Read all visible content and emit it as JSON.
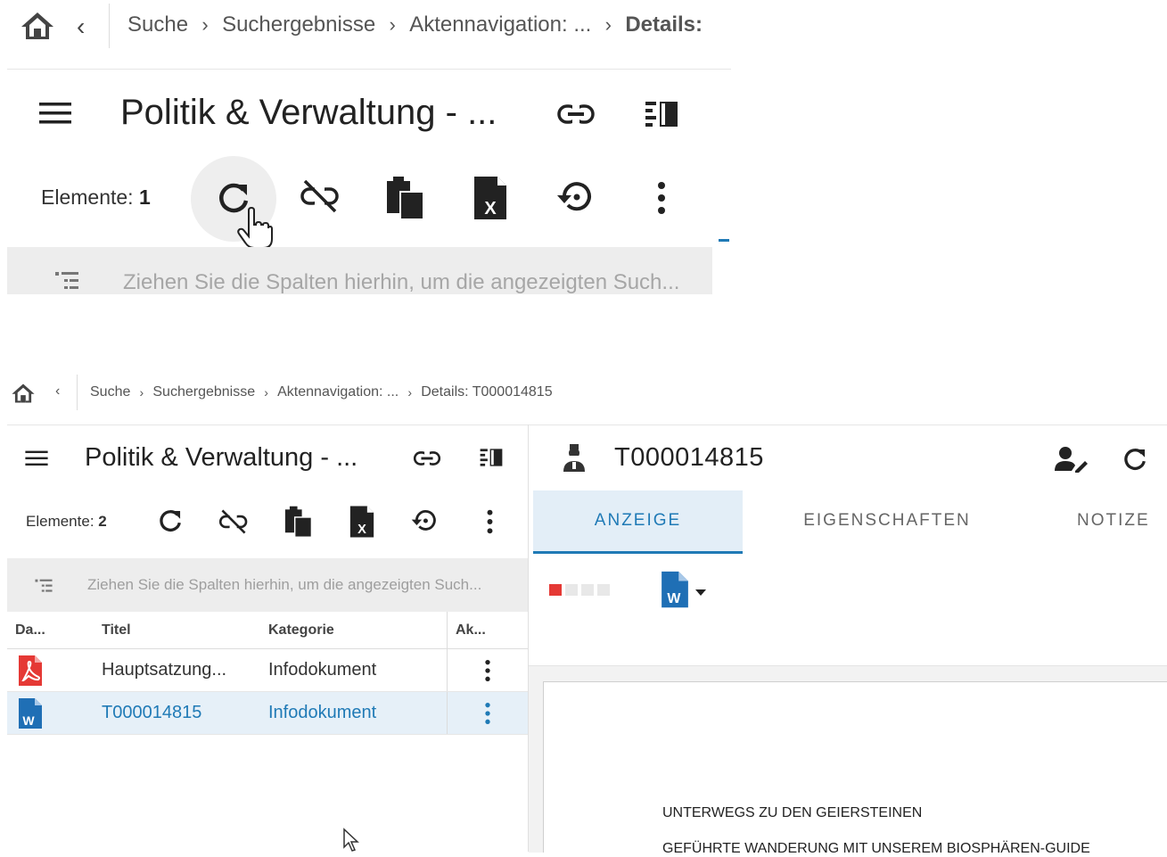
{
  "zoom": {
    "breadcrumb": [
      "Suche",
      "Suchergebnisse",
      "Aktennavigation: ...",
      "Details:"
    ],
    "title": "Politik & Verwaltung - ...",
    "count_label": "Elemente:",
    "count_value": "1",
    "group_hint": "Ziehen Sie die Spalten hierhin, um die angezeigten Such..."
  },
  "main": {
    "breadcrumb": [
      "Suche",
      "Suchergebnisse",
      "Aktennavigation: ...",
      "Details: T000014815"
    ],
    "title": "Politik & Verwaltung - ...",
    "count_label": "Elemente:",
    "count_value": "2",
    "group_hint": "Ziehen Sie die Spalten hierhin, um die angezeigten Such...",
    "columns": [
      "Da...",
      "Titel",
      "Kategorie",
      "Ak..."
    ],
    "rows": [
      {
        "type_icon": "pdf-icon",
        "title": "Hauptsatzung...",
        "category": "Infodokument",
        "selected": false
      },
      {
        "type_icon": "word-icon",
        "title": "T000014815",
        "category": "Infodokument",
        "selected": true
      }
    ]
  },
  "detail": {
    "title": "T000014815",
    "tabs": [
      "ANZEIGE",
      "EIGENSCHAFTEN",
      "NOTIZE"
    ],
    "active_tab": "ANZEIGE",
    "progress_steps": 4,
    "progress_done": 1,
    "doc_lines": [
      "UNTERWEGS ZU DEN GEIERSTEINEN",
      "GEFÜHRTE WANDERUNG MIT UNSEREM BIOSPHÄREN-GUIDE"
    ]
  },
  "colors": {
    "accent": "#1f7ab6",
    "pdf_red": "#e53935",
    "word_blue": "#1f6fb5",
    "selected_row_bg": "#e6f0f8",
    "tab_active_bg": "#e3eef7"
  }
}
